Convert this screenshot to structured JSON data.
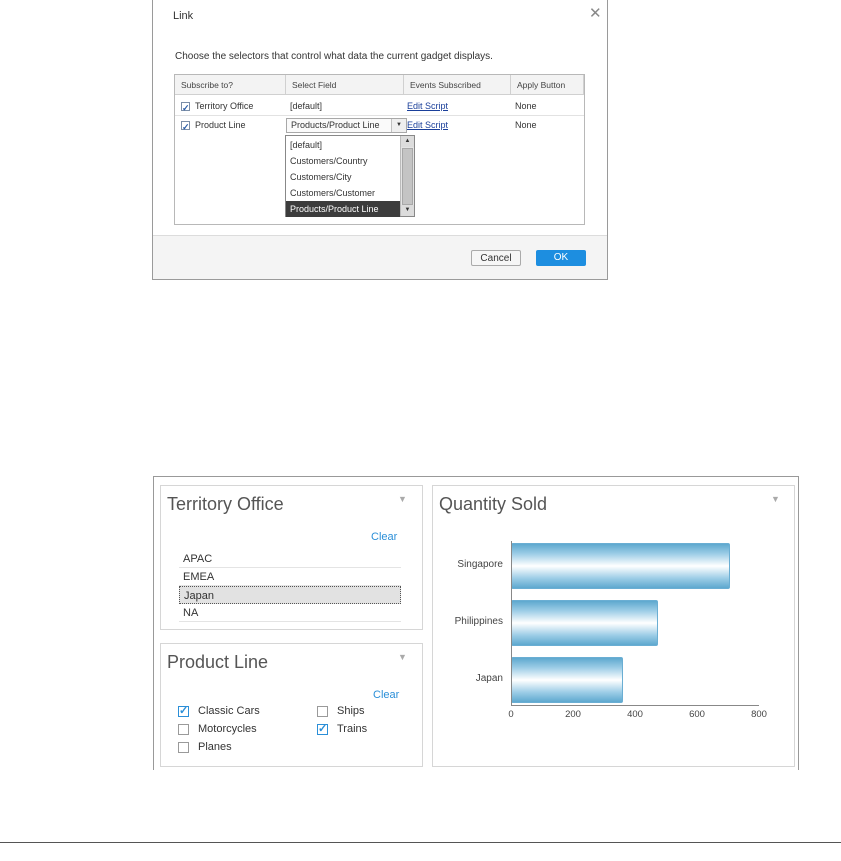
{
  "dialog": {
    "title": "Link",
    "close_icon": "close-icon",
    "description": "Choose the selectors that control what data the current gadget displays.",
    "columns": [
      "Subscribe to?",
      "Select Field",
      "Events Subscribed",
      "Apply Button"
    ],
    "rows": [
      {
        "checked": true,
        "name": "Territory Office",
        "field": "[default]",
        "events": "Edit Script",
        "apply": "None"
      },
      {
        "checked": true,
        "name": "Product Line",
        "field": "Products/Product Line",
        "events": "Edit Script",
        "apply": "None"
      }
    ],
    "dropdown_options": [
      "[default]",
      "Customers/Country",
      "Customers/City",
      "Customers/Customer",
      "Products/Product Line"
    ],
    "dropdown_selected": "Products/Product Line",
    "cancel_label": "Cancel",
    "ok_label": "OK"
  },
  "territory_panel": {
    "title": "Territory Office",
    "clear_label": "Clear",
    "items": [
      "APAC",
      "EMEA",
      "Japan",
      "NA"
    ],
    "selected": "Japan"
  },
  "product_panel": {
    "title": "Product Line",
    "clear_label": "Clear",
    "options": [
      {
        "label": "Classic Cars",
        "checked": true
      },
      {
        "label": "Ships",
        "checked": false
      },
      {
        "label": "Motorcycles",
        "checked": false
      },
      {
        "label": "Trains",
        "checked": true
      },
      {
        "label": "Planes",
        "checked": false
      }
    ]
  },
  "chart_panel": {
    "title": "Quantity Sold"
  },
  "chart_data": {
    "type": "bar",
    "orientation": "horizontal",
    "title": "Quantity Sold",
    "categories": [
      "Singapore",
      "Philippines",
      "Japan"
    ],
    "values": [
      705,
      475,
      360
    ],
    "xlim": [
      0,
      800
    ],
    "xticks": [
      "0",
      "200",
      "400",
      "600",
      "800"
    ],
    "bar_colors": [
      "#5ea8cf",
      "#ffffff"
    ]
  }
}
